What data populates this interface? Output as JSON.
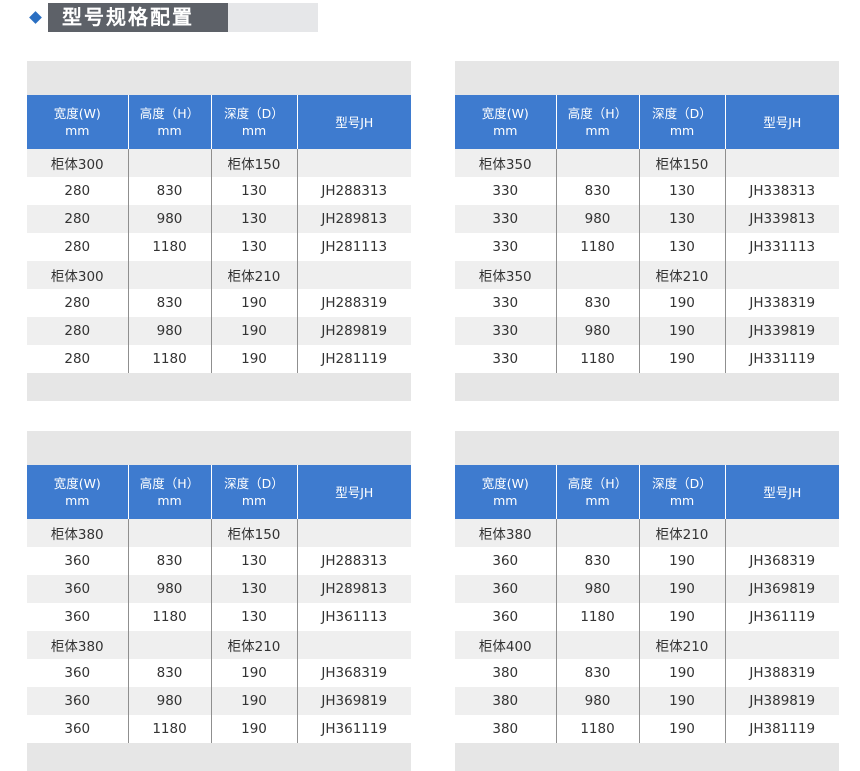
{
  "header": {
    "title": "型号规格配置"
  },
  "headers": {
    "width_line1": "宽度(W)",
    "width_line2": "mm",
    "height_line1": "高度（H）",
    "height_line2": "mm",
    "depth_line1": "深度（D）",
    "depth_line2": "mm",
    "model": "型号JH"
  },
  "tables": [
    {
      "rows": [
        [
          "柜体300",
          "",
          "柜体150",
          ""
        ],
        [
          "280",
          "830",
          "130",
          "JH288313"
        ],
        [
          "280",
          "980",
          "130",
          "JH289813"
        ],
        [
          "280",
          "1180",
          "130",
          "JH281113"
        ],
        [
          "柜体300",
          "",
          "柜体210",
          ""
        ],
        [
          "280",
          "830",
          "190",
          "JH288319"
        ],
        [
          "280",
          "980",
          "190",
          "JH289819"
        ],
        [
          "280",
          "1180",
          "190",
          "JH281119"
        ]
      ]
    },
    {
      "rows": [
        [
          "柜体350",
          "",
          "柜体150",
          ""
        ],
        [
          "330",
          "830",
          "130",
          "JH338313"
        ],
        [
          "330",
          "980",
          "130",
          "JH339813"
        ],
        [
          "330",
          "1180",
          "130",
          "JH331113"
        ],
        [
          "柜体350",
          "",
          "柜体210",
          ""
        ],
        [
          "330",
          "830",
          "190",
          "JH338319"
        ],
        [
          "330",
          "980",
          "190",
          "JH339819"
        ],
        [
          "330",
          "1180",
          "190",
          "JH331119"
        ]
      ]
    },
    {
      "rows": [
        [
          "柜体380",
          "",
          "柜体150",
          ""
        ],
        [
          "360",
          "830",
          "130",
          "JH288313"
        ],
        [
          "360",
          "980",
          "130",
          "JH289813"
        ],
        [
          "360",
          "1180",
          "130",
          "JH361113"
        ],
        [
          "柜体380",
          "",
          "柜体210",
          ""
        ],
        [
          "360",
          "830",
          "190",
          "JH368319"
        ],
        [
          "360",
          "980",
          "190",
          "JH369819"
        ],
        [
          "360",
          "1180",
          "190",
          "JH361119"
        ]
      ]
    },
    {
      "rows": [
        [
          "柜体380",
          "",
          "柜体210",
          ""
        ],
        [
          "360",
          "830",
          "190",
          "JH368319"
        ],
        [
          "360",
          "980",
          "190",
          "JH369819"
        ],
        [
          "360",
          "1180",
          "190",
          "JH361119"
        ],
        [
          "柜体400",
          "",
          "柜体210",
          ""
        ],
        [
          "380",
          "830",
          "190",
          "JH388319"
        ],
        [
          "380",
          "980",
          "190",
          "JH389819"
        ],
        [
          "380",
          "1180",
          "190",
          "JH381119"
        ]
      ]
    }
  ]
}
